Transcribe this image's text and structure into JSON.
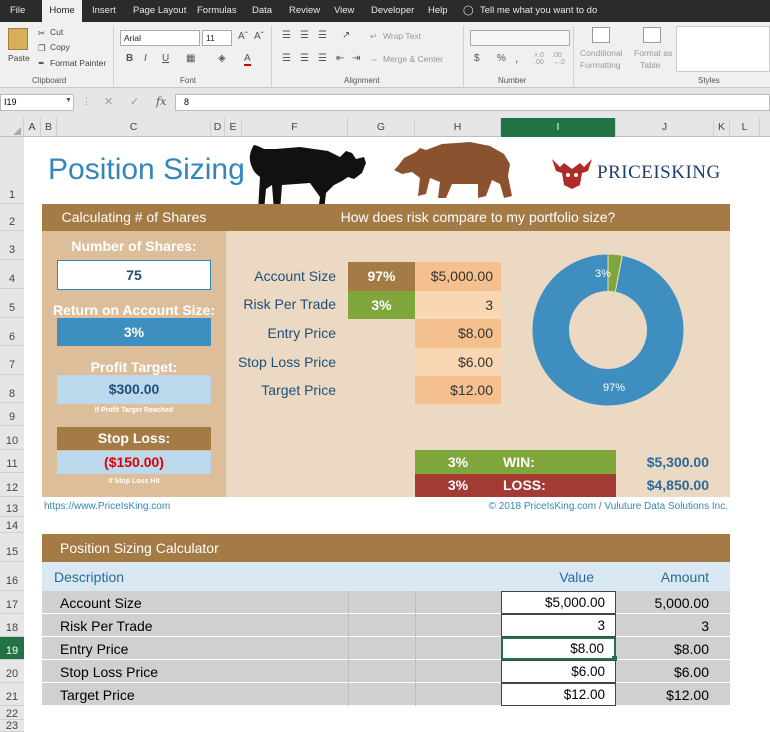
{
  "menu": {
    "tabs": [
      "File",
      "Home",
      "Insert",
      "Page Layout",
      "Formulas",
      "Data",
      "Review",
      "View",
      "Developer",
      "Help"
    ],
    "active_tab": "Home",
    "tell_me": "Tell me what you want to do"
  },
  "ribbon": {
    "clipboard": {
      "paste": "Paste",
      "cut": "Cut",
      "copy": "Copy",
      "format_painter": "Format Painter",
      "label": "Clipboard"
    },
    "font": {
      "name": "Arial",
      "size": "11",
      "label": "Font",
      "bold": "B",
      "italic": "I",
      "underline": "U"
    },
    "alignment": {
      "wrap_text": "Wrap Text",
      "merge_center": "Merge & Center",
      "label": "Alignment"
    },
    "number": {
      "label": "Number",
      "currency": "$",
      "percent": "%",
      "comma": ","
    },
    "styles": {
      "conditional": "Conditional",
      "formatting": "Formatting",
      "format_as": "Format as",
      "table": "Table",
      "label": "Styles"
    }
  },
  "formula_bar": {
    "name_box": "I19",
    "fx": "fx",
    "cancel": "✕",
    "enter": "✓",
    "value": "8"
  },
  "columns": [
    "A",
    "B",
    "C",
    "D",
    "E",
    "F",
    "G",
    "H",
    "I",
    "J",
    "K",
    "L"
  ],
  "selected_column": "I",
  "rows": [
    "1",
    "2",
    "3",
    "4",
    "5",
    "6",
    "7",
    "8",
    "9",
    "10",
    "11",
    "12",
    "13",
    "14",
    "15",
    "16",
    "17",
    "18",
    "19",
    "20",
    "21",
    "22",
    "23"
  ],
  "selected_row": "19",
  "sheet": {
    "title": "Position Sizing",
    "brand": "PRICEISKING",
    "left_header": "Calculating # of Shares",
    "right_header": "How does risk compare to my portfolio size?",
    "num_shares_label": "Number of Shares:",
    "num_shares_value": "75",
    "return_label": "Return on Account Size:",
    "return_value": "3%",
    "profit_label": "Profit Target:",
    "profit_value": "$300.00",
    "profit_note": "If Profit Target Reached",
    "stop_label": "Stop Loss:",
    "stop_value": "($150.00)",
    "stop_note": "If Stop Loss Hit",
    "account_size_label": "Account Size",
    "account_size_pct": "97%",
    "account_size_value": "$5,000.00",
    "risk_label": "Risk Per Trade",
    "risk_pct": "3%",
    "risk_value": "3",
    "entry_label": "Entry Price",
    "entry_value": "$8.00",
    "stoploss_label": "Stop Loss Price",
    "stoploss_value": "$6.00",
    "target_label": "Target Price",
    "target_value": "$12.00",
    "win_pct": "3%",
    "win_label": "WIN:",
    "win_value": "$5,300.00",
    "loss_pct": "3%",
    "loss_label": "LOSS:",
    "loss_value": "$4,850.00",
    "website": "https://www.PriceIsKing.com",
    "copyright": "© 2018 PriceIsKing.com / Vuluture Data Solutions Inc.",
    "calc_title": "Position Sizing Calculator",
    "calc_headers": {
      "description": "Description",
      "value": "Value",
      "amount": "Amount"
    },
    "calc_rows": [
      {
        "description": "Account Size",
        "value": "$5,000.00",
        "amount": "5,000.00"
      },
      {
        "description": "Risk Per Trade",
        "value": "3",
        "amount": "3"
      },
      {
        "description": "Entry Price",
        "value": "$8.00",
        "amount": "$8.00"
      },
      {
        "description": "Stop Loss Price",
        "value": "$6.00",
        "amount": "$6.00"
      },
      {
        "description": "Target Price",
        "value": "$12.00",
        "amount": "$12.00"
      }
    ]
  },
  "chart_data": {
    "type": "pie",
    "categories": [
      "Account Size",
      "Risk Per Trade"
    ],
    "values": [
      97,
      3
    ],
    "labels": [
      "97%",
      "3%"
    ],
    "colors": [
      "#3e8ec0",
      "#7ea63b"
    ],
    "donut": true
  },
  "colors": {
    "brown": "#a47a45",
    "tan": "#dcbf9a",
    "panel": "#ecd9c3",
    "blue": "#3e8ec0",
    "light_blue": "#bcd8ec",
    "green": "#7ea63b",
    "red": "#a33a33",
    "orange": "#f4c08e",
    "light_orange": "#f8d7b2",
    "title_blue": "#3486b9",
    "excel_green": "#217346"
  }
}
